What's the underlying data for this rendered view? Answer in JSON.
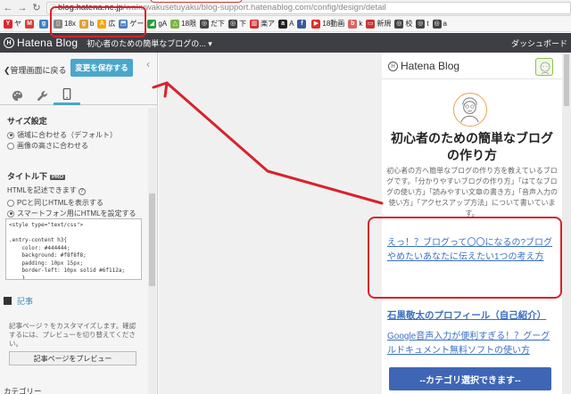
{
  "browser": {
    "back_icon": "arrow-left-icon",
    "forward_icon": "arrow-right-icon",
    "reload_icon": "reload-icon",
    "info_icon": "info-icon",
    "url_host": "blog.hatena.ne.jp",
    "url_path": "/wakuwakusetuyaku/blog-support.hatenablog.com/config/design/detail",
    "bookmarks": [
      {
        "icon": "Y",
        "color": "#e0262b",
        "label": "ヤ"
      },
      {
        "icon": "M",
        "color": "#d23f31",
        "label": ""
      },
      {
        "icon": "g",
        "color": "#3b82c4",
        "label": ""
      },
      {
        "icon": "▯",
        "color": "#888888",
        "label": "18x"
      },
      {
        "icon": "g",
        "color": "#e0a030",
        "label": "b"
      },
      {
        "icon": "A",
        "color": "#f7a600",
        "label": "広"
      },
      {
        "icon": "⬒",
        "color": "#4a7fc1",
        "label": "ゲー"
      },
      {
        "icon": "◢",
        "color": "#2a9d3a",
        "label": "gA"
      },
      {
        "icon": "△",
        "color": "#7cb342",
        "label": "18限"
      },
      {
        "icon": "◎",
        "color": "#444444",
        "label": "だ下"
      },
      {
        "icon": "◎",
        "color": "#444444",
        "label": "下"
      },
      {
        "icon": "▥",
        "color": "#d32f2f",
        "label": "楽ア"
      },
      {
        "icon": "a",
        "color": "#222222",
        "label": "A"
      },
      {
        "icon": "f",
        "color": "#3b5998",
        "label": ""
      },
      {
        "icon": "▶",
        "color": "#e52d27",
        "label": "18動画"
      },
      {
        "icon": "b",
        "color": "#e06060",
        "label": "k"
      },
      {
        "icon": "▭",
        "color": "#cc3333",
        "label": "新規"
      },
      {
        "icon": "◎",
        "color": "#444444",
        "label": "校"
      },
      {
        "icon": "◎",
        "color": "#444444",
        "label": "t"
      },
      {
        "icon": "◎",
        "color": "#444444",
        "label": "a"
      }
    ]
  },
  "header": {
    "logo_text": "Hatena Blog",
    "blog_name": "初心者のための簡単なブログの...",
    "dashboard_label": "ダッシュボード"
  },
  "sidebar": {
    "back_label": "管理画面に戻る",
    "save_label": "変更を保存する",
    "size_section": "サイズ設定",
    "radio_fit_area": "領域に合わせる（デフォルト）",
    "radio_fit_height": "画像の高さに合わせる",
    "title_below": "タイトル下",
    "pro_badge": "PRO",
    "html_note": "HTMLを記述できます",
    "radio_same_pc": "PCと同じHTMLを表示する",
    "radio_smartphone": "スマートフォン用にHTMLを設定する",
    "css_code": "<style type=\"text/css\">\n\n.entry-content h3{\n    color: #444444;\n    background: #f8f8f8;\n    padding: 10px 15px;\n    border-left: 10px solid #6f112a;\n    }",
    "article_label": "記事",
    "article_hint": "記事ページ ? をカスタマイズします。確認するには、プレビューを切り替えてください。",
    "preview_article_btn": "記事ページをプレビュー",
    "category_label": "カテゴリー"
  },
  "phone": {
    "logo_text": "Hatena Blog",
    "title_line1": "初心者のための簡単なブログ",
    "title_line2": "の作り方",
    "description": "初心者の方へ簡単なブログの作り方を教えているブログです。「分かりやすいブログの作り方」「はてなブログの使い方」「読みやすい文章の書き方」「音声入力の使い方」「アクセスアップ方法」について書いています。",
    "link1": "えっ！？ブログって〇〇になるの?ブログやめたいあなたに伝えたい1つの考え方",
    "link2": "石黒敬太のプロフィール（自己紹介）",
    "link3": "Google音声入力が便利すぎる！？グーグルドキュメント無料ソフトの使い方",
    "category_button": "--カテゴリ選択できます--"
  },
  "colors": {
    "save_button": "#4ba7c9",
    "header_bg": "#3d3f44",
    "link": "#3a6fc4",
    "annotation_red": "#d8222b",
    "category_button": "#3f66b5"
  }
}
